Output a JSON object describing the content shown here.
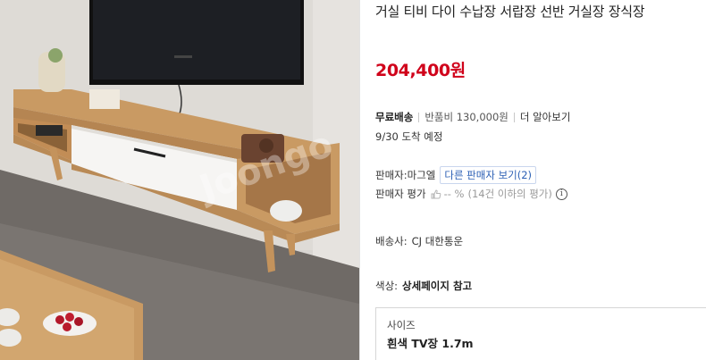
{
  "product": {
    "title": "거실 티비 다이 수납장 서랍장 선반 거실장 장식장",
    "price": "204,400원",
    "image_alt": "거실장 제품 사진"
  },
  "shipping": {
    "free_label": "무료배송",
    "return_fee": "반품비 130,000원",
    "more_label": "더 알아보기",
    "arrival": "9/30 도착 예정"
  },
  "seller": {
    "label": "판매자:마그엘",
    "other_items_button": "다른 판매자 보기(2)",
    "rating_label": "판매자 평가",
    "rating_value": "-- %",
    "rating_note": "(14건 이하의 평가)"
  },
  "delivery": {
    "label": "배송사:",
    "carrier": "CJ 대한통운"
  },
  "color": {
    "label": "색상:",
    "value": "상세페이지 참고"
  },
  "option": {
    "label": "사이즈",
    "value": "흰색 TV장 1.7m"
  },
  "icons": {
    "thumb": "thumbs-up-icon",
    "info": "info-circle-icon"
  },
  "colors": {
    "price": "#d0021b",
    "seller_button_text": "#2b5fb4"
  }
}
